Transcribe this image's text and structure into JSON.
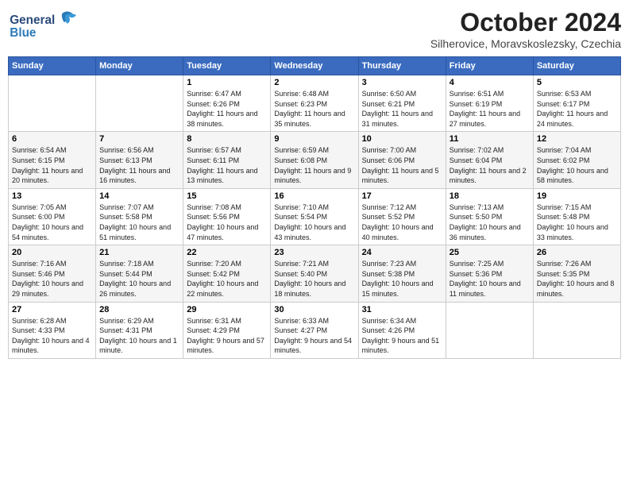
{
  "logo": {
    "line1": "General",
    "line2": "Blue"
  },
  "title": "October 2024",
  "location": "Silherovice, Moravskoslezsky, Czechia",
  "weekdays": [
    "Sunday",
    "Monday",
    "Tuesday",
    "Wednesday",
    "Thursday",
    "Friday",
    "Saturday"
  ],
  "weeks": [
    [
      {
        "day": "",
        "sunrise": "",
        "sunset": "",
        "daylight": ""
      },
      {
        "day": "",
        "sunrise": "",
        "sunset": "",
        "daylight": ""
      },
      {
        "day": "1",
        "sunrise": "Sunrise: 6:47 AM",
        "sunset": "Sunset: 6:26 PM",
        "daylight": "Daylight: 11 hours and 38 minutes."
      },
      {
        "day": "2",
        "sunrise": "Sunrise: 6:48 AM",
        "sunset": "Sunset: 6:23 PM",
        "daylight": "Daylight: 11 hours and 35 minutes."
      },
      {
        "day": "3",
        "sunrise": "Sunrise: 6:50 AM",
        "sunset": "Sunset: 6:21 PM",
        "daylight": "Daylight: 11 hours and 31 minutes."
      },
      {
        "day": "4",
        "sunrise": "Sunrise: 6:51 AM",
        "sunset": "Sunset: 6:19 PM",
        "daylight": "Daylight: 11 hours and 27 minutes."
      },
      {
        "day": "5",
        "sunrise": "Sunrise: 6:53 AM",
        "sunset": "Sunset: 6:17 PM",
        "daylight": "Daylight: 11 hours and 24 minutes."
      }
    ],
    [
      {
        "day": "6",
        "sunrise": "Sunrise: 6:54 AM",
        "sunset": "Sunset: 6:15 PM",
        "daylight": "Daylight: 11 hours and 20 minutes."
      },
      {
        "day": "7",
        "sunrise": "Sunrise: 6:56 AM",
        "sunset": "Sunset: 6:13 PM",
        "daylight": "Daylight: 11 hours and 16 minutes."
      },
      {
        "day": "8",
        "sunrise": "Sunrise: 6:57 AM",
        "sunset": "Sunset: 6:11 PM",
        "daylight": "Daylight: 11 hours and 13 minutes."
      },
      {
        "day": "9",
        "sunrise": "Sunrise: 6:59 AM",
        "sunset": "Sunset: 6:08 PM",
        "daylight": "Daylight: 11 hours and 9 minutes."
      },
      {
        "day": "10",
        "sunrise": "Sunrise: 7:00 AM",
        "sunset": "Sunset: 6:06 PM",
        "daylight": "Daylight: 11 hours and 5 minutes."
      },
      {
        "day": "11",
        "sunrise": "Sunrise: 7:02 AM",
        "sunset": "Sunset: 6:04 PM",
        "daylight": "Daylight: 11 hours and 2 minutes."
      },
      {
        "day": "12",
        "sunrise": "Sunrise: 7:04 AM",
        "sunset": "Sunset: 6:02 PM",
        "daylight": "Daylight: 10 hours and 58 minutes."
      }
    ],
    [
      {
        "day": "13",
        "sunrise": "Sunrise: 7:05 AM",
        "sunset": "Sunset: 6:00 PM",
        "daylight": "Daylight: 10 hours and 54 minutes."
      },
      {
        "day": "14",
        "sunrise": "Sunrise: 7:07 AM",
        "sunset": "Sunset: 5:58 PM",
        "daylight": "Daylight: 10 hours and 51 minutes."
      },
      {
        "day": "15",
        "sunrise": "Sunrise: 7:08 AM",
        "sunset": "Sunset: 5:56 PM",
        "daylight": "Daylight: 10 hours and 47 minutes."
      },
      {
        "day": "16",
        "sunrise": "Sunrise: 7:10 AM",
        "sunset": "Sunset: 5:54 PM",
        "daylight": "Daylight: 10 hours and 43 minutes."
      },
      {
        "day": "17",
        "sunrise": "Sunrise: 7:12 AM",
        "sunset": "Sunset: 5:52 PM",
        "daylight": "Daylight: 10 hours and 40 minutes."
      },
      {
        "day": "18",
        "sunrise": "Sunrise: 7:13 AM",
        "sunset": "Sunset: 5:50 PM",
        "daylight": "Daylight: 10 hours and 36 minutes."
      },
      {
        "day": "19",
        "sunrise": "Sunrise: 7:15 AM",
        "sunset": "Sunset: 5:48 PM",
        "daylight": "Daylight: 10 hours and 33 minutes."
      }
    ],
    [
      {
        "day": "20",
        "sunrise": "Sunrise: 7:16 AM",
        "sunset": "Sunset: 5:46 PM",
        "daylight": "Daylight: 10 hours and 29 minutes."
      },
      {
        "day": "21",
        "sunrise": "Sunrise: 7:18 AM",
        "sunset": "Sunset: 5:44 PM",
        "daylight": "Daylight: 10 hours and 26 minutes."
      },
      {
        "day": "22",
        "sunrise": "Sunrise: 7:20 AM",
        "sunset": "Sunset: 5:42 PM",
        "daylight": "Daylight: 10 hours and 22 minutes."
      },
      {
        "day": "23",
        "sunrise": "Sunrise: 7:21 AM",
        "sunset": "Sunset: 5:40 PM",
        "daylight": "Daylight: 10 hours and 18 minutes."
      },
      {
        "day": "24",
        "sunrise": "Sunrise: 7:23 AM",
        "sunset": "Sunset: 5:38 PM",
        "daylight": "Daylight: 10 hours and 15 minutes."
      },
      {
        "day": "25",
        "sunrise": "Sunrise: 7:25 AM",
        "sunset": "Sunset: 5:36 PM",
        "daylight": "Daylight: 10 hours and 11 minutes."
      },
      {
        "day": "26",
        "sunrise": "Sunrise: 7:26 AM",
        "sunset": "Sunset: 5:35 PM",
        "daylight": "Daylight: 10 hours and 8 minutes."
      }
    ],
    [
      {
        "day": "27",
        "sunrise": "Sunrise: 6:28 AM",
        "sunset": "Sunset: 4:33 PM",
        "daylight": "Daylight: 10 hours and 4 minutes."
      },
      {
        "day": "28",
        "sunrise": "Sunrise: 6:29 AM",
        "sunset": "Sunset: 4:31 PM",
        "daylight": "Daylight: 10 hours and 1 minute."
      },
      {
        "day": "29",
        "sunrise": "Sunrise: 6:31 AM",
        "sunset": "Sunset: 4:29 PM",
        "daylight": "Daylight: 9 hours and 57 minutes."
      },
      {
        "day": "30",
        "sunrise": "Sunrise: 6:33 AM",
        "sunset": "Sunset: 4:27 PM",
        "daylight": "Daylight: 9 hours and 54 minutes."
      },
      {
        "day": "31",
        "sunrise": "Sunrise: 6:34 AM",
        "sunset": "Sunset: 4:26 PM",
        "daylight": "Daylight: 9 hours and 51 minutes."
      },
      {
        "day": "",
        "sunrise": "",
        "sunset": "",
        "daylight": ""
      },
      {
        "day": "",
        "sunrise": "",
        "sunset": "",
        "daylight": ""
      }
    ]
  ]
}
